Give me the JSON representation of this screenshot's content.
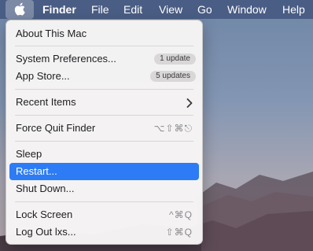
{
  "menubar": {
    "apple_icon": "apple-logo-icon",
    "items": [
      "Finder",
      "File",
      "Edit",
      "View",
      "Go",
      "Window",
      "Help"
    ]
  },
  "apple_menu": {
    "about": "About This Mac",
    "system_preferences": {
      "label": "System Preferences...",
      "badge": "1 update"
    },
    "app_store": {
      "label": "App Store...",
      "badge": "5 updates"
    },
    "recent_items": {
      "label": "Recent Items",
      "submenu_icon": "chevron-right-icon"
    },
    "force_quit": {
      "label": "Force Quit Finder",
      "shortcut": "⌥⇧⌘⎋"
    },
    "sleep": "Sleep",
    "restart": "Restart...",
    "shut_down": "Shut Down...",
    "lock_screen": {
      "label": "Lock Screen",
      "shortcut": "^⌘Q"
    },
    "log_out": {
      "label": "Log Out lxs...",
      "shortcut": "⇧⌘Q"
    }
  },
  "colors": {
    "highlight": "#2d7cf6",
    "menubar": "#4a5d84"
  }
}
